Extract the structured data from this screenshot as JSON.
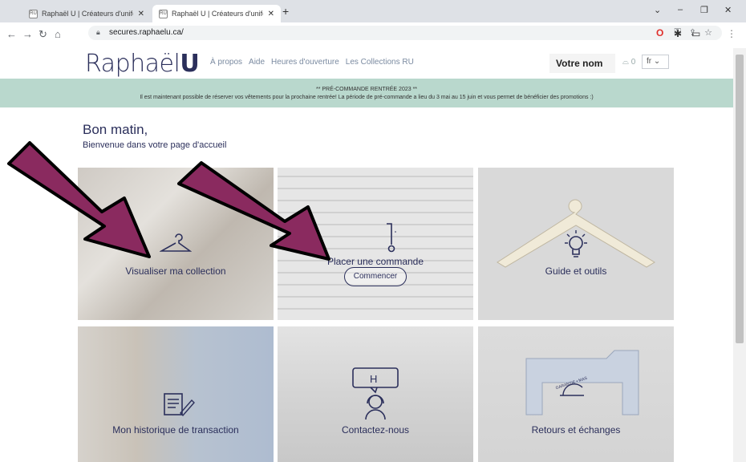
{
  "browser": {
    "tabs": [
      {
        "title": "Raphaël U | Créateurs d'uniforme",
        "favicon": "RU"
      },
      {
        "title": "Raphaël U | Créateurs d'uniforme",
        "favicon": "RU"
      }
    ],
    "url": "secures.raphaelu.ca/"
  },
  "header": {
    "logo_text": "Raphaël",
    "logo_u": "U",
    "nav": [
      "À propos",
      "Aide",
      "Heures d'ouverture",
      "Les Collections RU"
    ],
    "username": "Votre nom",
    "cart_count": "0",
    "language": "fr"
  },
  "banner": {
    "title": "** PRÉ-COMMANDE RENTRÉE 2023 **",
    "text": "Il est maintenant possible de réserver vos vêtements pour la prochaine rentrée! La période de pré-commande a lieu du 3 mai au 15 juin et vous permet de bénéficier des promotions :)"
  },
  "greeting": {
    "title": "Bon matin,",
    "subtitle": "Bienvenue dans votre page d'accueil"
  },
  "tiles": [
    {
      "label": "Visualiser ma collection",
      "icon": "hanger-icon"
    },
    {
      "label": "Placer une commande",
      "icon": "hook-icon",
      "button": "Commencer"
    },
    {
      "label": "Guide et outils",
      "icon": "lightbulb-icon"
    },
    {
      "label": "Mon historique de transaction",
      "icon": "document-pen-icon"
    },
    {
      "label": "Contactez-nous",
      "icon": "headset-icon",
      "chat_letter": "H"
    },
    {
      "label": "Retours et échanges",
      "icon": "sewing-machine-icon",
      "tag_text": "GARANTIE • MAS"
    }
  ],
  "colors": {
    "brand": "#2b2f5b",
    "banner": "#b9d8cd",
    "arrow_fill": "#8a2a5f"
  }
}
